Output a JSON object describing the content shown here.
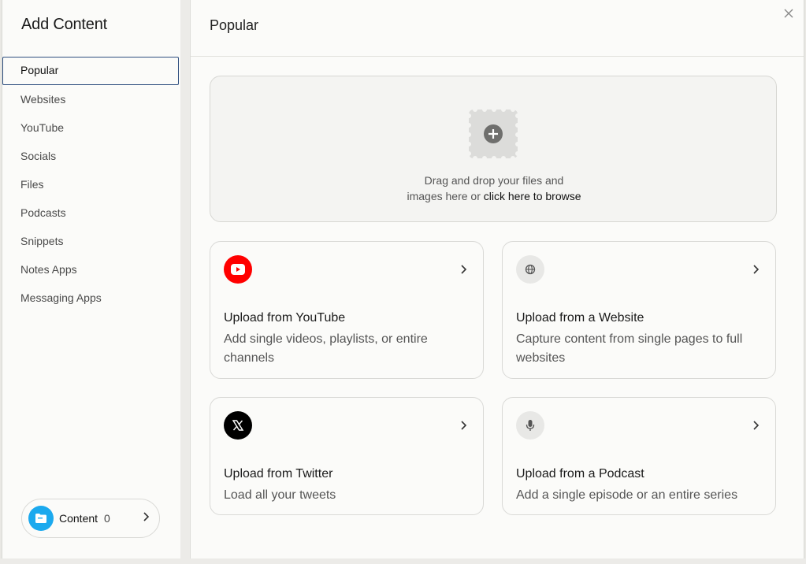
{
  "sidebar": {
    "title": "Add Content",
    "items": [
      {
        "label": "Popular"
      },
      {
        "label": "Websites"
      },
      {
        "label": "YouTube"
      },
      {
        "label": "Socials"
      },
      {
        "label": "Files"
      },
      {
        "label": "Podcasts"
      },
      {
        "label": "Snippets"
      },
      {
        "label": "Notes Apps"
      },
      {
        "label": "Messaging Apps"
      }
    ],
    "content_pill": {
      "label": "Content",
      "count": "0",
      "icon": "folder-icon"
    }
  },
  "main": {
    "title": "Popular",
    "close_icon": "close-icon",
    "dropzone": {
      "line1": "Drag and drop your files and",
      "line2_prefix": "images here or ",
      "line2_link": "click here to browse",
      "icon": "add-file-icon"
    },
    "cards": [
      {
        "title": "Upload from YouTube",
        "desc": "Add single videos, playlists, or entire channels",
        "icon": "youtube-icon"
      },
      {
        "title": "Upload from a Website",
        "desc": "Capture content from single pages to full websites",
        "icon": "globe-icon"
      },
      {
        "title": "Upload from Twitter",
        "desc": "Load all your tweets",
        "icon": "x-twitter-icon"
      },
      {
        "title": "Upload from a Podcast",
        "desc": "Add a single episode or an entire series",
        "icon": "microphone-icon"
      }
    ]
  },
  "colors": {
    "accent_active_border": "#2f4f7f",
    "youtube_red": "#ff0000",
    "pill_blue": "#1ba9ee"
  }
}
